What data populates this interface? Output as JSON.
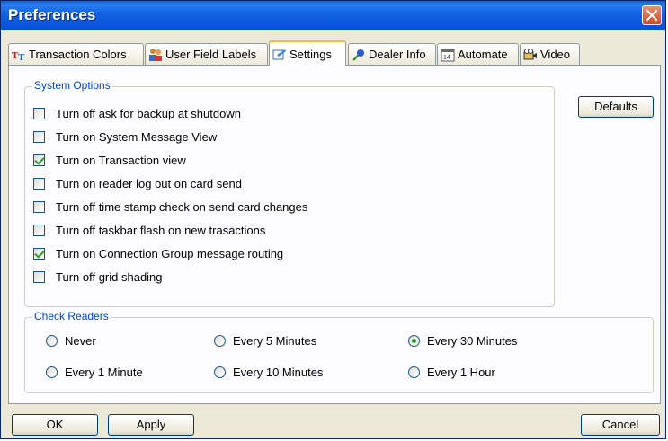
{
  "window": {
    "title": "Preferences",
    "close_icon": "close-icon"
  },
  "tabs": [
    {
      "label": "Transaction Colors",
      "icon": "text-color-icon"
    },
    {
      "label": "User Field Labels",
      "icon": "users-icon"
    },
    {
      "label": "Settings",
      "icon": "settings-icon",
      "active": true
    },
    {
      "label": "Dealer Info",
      "icon": "pin-icon"
    },
    {
      "label": "Automate",
      "icon": "calendar-icon"
    },
    {
      "label": "Video",
      "icon": "camera-icon"
    }
  ],
  "system_options": {
    "legend": "System Options",
    "items": [
      {
        "label": "Turn off ask for backup at shutdown",
        "checked": false
      },
      {
        "label": "Turn on System Message View",
        "checked": false
      },
      {
        "label": "Turn on Transaction view",
        "checked": true
      },
      {
        "label": "Turn on reader log out on card send",
        "checked": false
      },
      {
        "label": "Turn off time stamp check on send card changes",
        "checked": false
      },
      {
        "label": "Turn off taskbar flash on new trasactions",
        "checked": false
      },
      {
        "label": "Turn on Connection Group message routing",
        "checked": true
      },
      {
        "label": "Turn off grid shading",
        "checked": false
      }
    ]
  },
  "defaults_button": "Defaults",
  "check_readers": {
    "legend": "Check Readers",
    "options": [
      {
        "label": "Never",
        "selected": false
      },
      {
        "label": "Every 5 Minutes",
        "selected": false
      },
      {
        "label": "Every 30 Minutes",
        "selected": true
      },
      {
        "label": "Every 1 Minute",
        "selected": false
      },
      {
        "label": "Every 10 Minutes",
        "selected": false
      },
      {
        "label": "Every 1 Hour",
        "selected": false
      }
    ]
  },
  "footer": {
    "ok": "OK",
    "apply": "Apply",
    "cancel": "Cancel"
  },
  "colors": {
    "title_bar": "#0751d6",
    "accent_check": "#21a121",
    "legend_text": "#0046d5"
  }
}
